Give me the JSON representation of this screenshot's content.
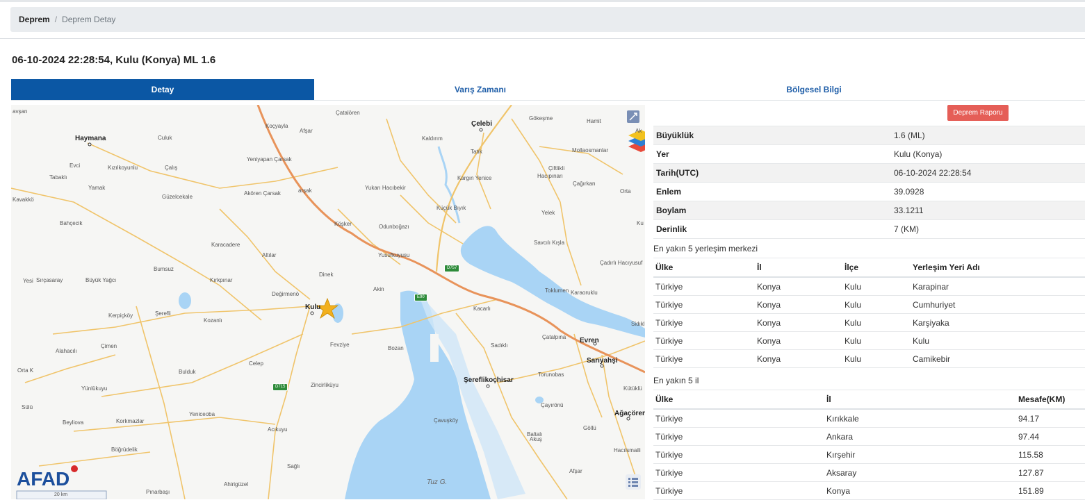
{
  "breadcrumb": {
    "home": "Deprem",
    "separator": "/",
    "current": "Deprem Detay"
  },
  "page_title": "06-10-2024 22:28:54, Kulu (Konya) ML 1.6",
  "tabs": [
    {
      "label": "Detay",
      "active": true
    },
    {
      "label": "Varış Zamanı",
      "active": false
    },
    {
      "label": "Bölgesel Bilgi",
      "active": false
    }
  ],
  "report_button": "Deprem Raporu",
  "details": [
    {
      "key": "Büyüklük",
      "value": "1.6 (ML)"
    },
    {
      "key": "Yer",
      "value": "Kulu (Konya)"
    },
    {
      "key": "Tarih(UTC)",
      "value": "06-10-2024 22:28:54"
    },
    {
      "key": "Enlem",
      "value": "39.0928"
    },
    {
      "key": "Boylam",
      "value": "33.1211"
    },
    {
      "key": "Derinlik",
      "value": "7 (KM)"
    }
  ],
  "settlements": {
    "title": "En yakın 5 yerleşim merkezi",
    "headers": [
      "Ülke",
      "İl",
      "İlçe",
      "Yerleşim Yeri Adı"
    ],
    "rows": [
      [
        "Türkiye",
        "Konya",
        "Kulu",
        "Karapinar"
      ],
      [
        "Türkiye",
        "Konya",
        "Kulu",
        "Cumhuriyet"
      ],
      [
        "Türkiye",
        "Konya",
        "Kulu",
        "Karşiyaka"
      ],
      [
        "Türkiye",
        "Konya",
        "Kulu",
        "Kulu"
      ],
      [
        "Türkiye",
        "Konya",
        "Kulu",
        "Camikebir"
      ]
    ]
  },
  "provinces": {
    "title": "En yakın 5 il",
    "headers": [
      "Ülke",
      "İl",
      "Mesafe(KM)"
    ],
    "rows": [
      [
        "Türkiye",
        "Kırıkkale",
        "94.17"
      ],
      [
        "Türkiye",
        "Ankara",
        "97.44"
      ],
      [
        "Türkiye",
        "Kırşehir",
        "115.58"
      ],
      [
        "Türkiye",
        "Aksaray",
        "127.87"
      ],
      [
        "Türkiye",
        "Konya",
        "151.89"
      ]
    ]
  },
  "map": {
    "logo": "AFAD",
    "scale": "20 km",
    "lake_label": "Tuz G.",
    "epicenter_icon": "star-icon",
    "layers_icon": "layers-icon",
    "legend_icon": "list-icon",
    "fullscreen_icon": "fullscreen-icon",
    "colors": {
      "water": "#a9d4f5",
      "road": "#f0c46a",
      "highway": "#e8935a",
      "epicenter": "#f2b01e",
      "logo": "#1c4f9c"
    },
    "cities": [
      "Haymana",
      "Çelebi",
      "Kulu",
      "Evren",
      "Sarıyahşi",
      "Şereflikoçhisar",
      "Ağaçören"
    ],
    "places": [
      "avşan",
      "Çatalören",
      "Gökeşme",
      "Hamit",
      "Koçyayla",
      "Afşar",
      "Culuk",
      "Evci",
      "Kızılkoyunlu",
      "Çalış",
      "Tabaklı",
      "Yamak",
      "Kavakkö",
      "Güzelcekale",
      "Bahçecik",
      "Yeniyapan Çarsak",
      "Akören Çarsak",
      "arşak",
      "Kaldırım",
      "Tatık",
      "Kargın Yenice",
      "Küçük Bıyık",
      "Yukarı Hacıbekir",
      "Çiftlikli",
      "Hacıpınarı",
      "Çağırkan",
      "Mollaosmanlar",
      "Orta",
      "Yelek",
      "Köşker",
      "Odunboğazı",
      "Karacadere",
      "Altılar",
      "Yusufkuyusu",
      "Savcılı Kışla",
      "Çadırlı Hacıyusuf",
      "Bumsuz",
      "Dinek",
      "Yesi",
      "Sırçasaray",
      "Büyük Yağcı",
      "Kırkpınar",
      "Değirmenö",
      "Akin",
      "Toklumen",
      "Karaoruklu",
      "Şerefli",
      "Kerpiçköy",
      "Kozanlı",
      "Kacarlı",
      "Sidıklı",
      "Alahacılı",
      "Çimen",
      "Fevziye",
      "Bozan",
      "Sadıklı",
      "Çatalpına",
      "Orta K",
      "Celep",
      "Bulduk",
      "Zincirliküyu",
      "Torunobas",
      "Kütüklü",
      "Yünlükuyu",
      "Sülü",
      "Beyliova",
      "Korkmazlar",
      "Yeniceoba",
      "Çavuşköy",
      "Çayırönü",
      "Böğrüdelik",
      "Acıkuyu",
      "Baltalı",
      "Göllü",
      "Hacılsmaili",
      "Sağlı",
      "Akuş",
      "Afşar",
      "Ahirigüzel",
      "Pınarbaşı",
      "Ak",
      "Ku"
    ],
    "road_badges": [
      "D757",
      "E90",
      "D715"
    ]
  }
}
